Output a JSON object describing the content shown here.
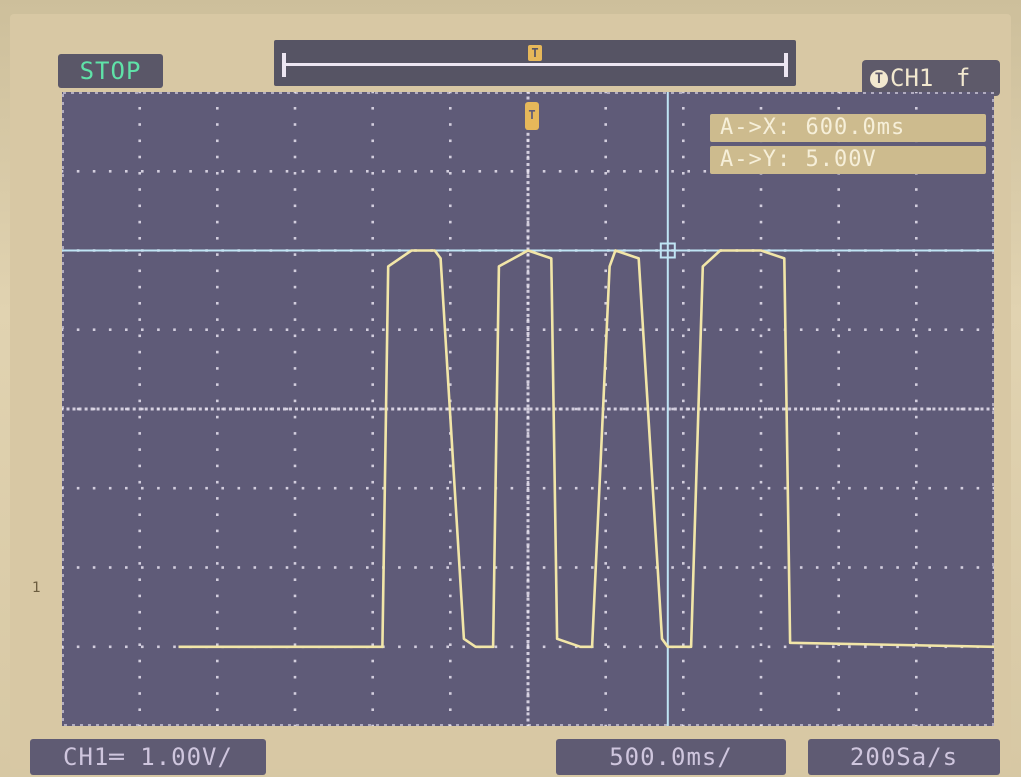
{
  "status": {
    "text": "STOP"
  },
  "trigger": {
    "marker": "T",
    "channel_label": "CH1",
    "edge_symbol": "f"
  },
  "cursors": {
    "delta_x": "A->X: 600.0ms",
    "delta_y": "A->Y: 5.00V"
  },
  "channel_marker": "1",
  "bottom": {
    "channel_scale": "CH1═ 1.00V/",
    "time_scale": "500.0ms/",
    "sample_rate": "200Sa/s"
  },
  "colors": {
    "trace": "#f2e6a8",
    "grid": "#e8e3f0",
    "cursor": "#bfe4f4",
    "status_text": "#5fe2a8",
    "plot_bg": "#5f5b78"
  },
  "chart_data": {
    "type": "line",
    "series": [
      {
        "x": [
          -3.0,
          -1.25,
          -1.2,
          -1.0,
          -0.8,
          -0.75,
          -0.55,
          -0.45,
          -0.3,
          -0.25,
          0.0,
          0.2,
          0.25,
          0.45,
          0.55,
          0.7,
          0.75,
          0.95,
          1.15,
          1.2,
          1.4,
          1.5,
          1.65,
          1.7,
          2.0,
          2.2,
          2.25,
          4.0
        ],
        "y": [
          0.0,
          0.0,
          4.8,
          5.0,
          5.0,
          4.9,
          0.1,
          0.0,
          0.0,
          4.8,
          5.0,
          4.9,
          0.1,
          0.0,
          0.0,
          4.8,
          5.0,
          4.9,
          0.1,
          0.0,
          0.0,
          4.8,
          5.0,
          5.0,
          5.0,
          4.9,
          0.05,
          0.0
        ]
      }
    ],
    "xlim": [
      -4.0,
      4.0
    ],
    "ylim": [
      -1.0,
      7.0
    ],
    "grid": true
  }
}
